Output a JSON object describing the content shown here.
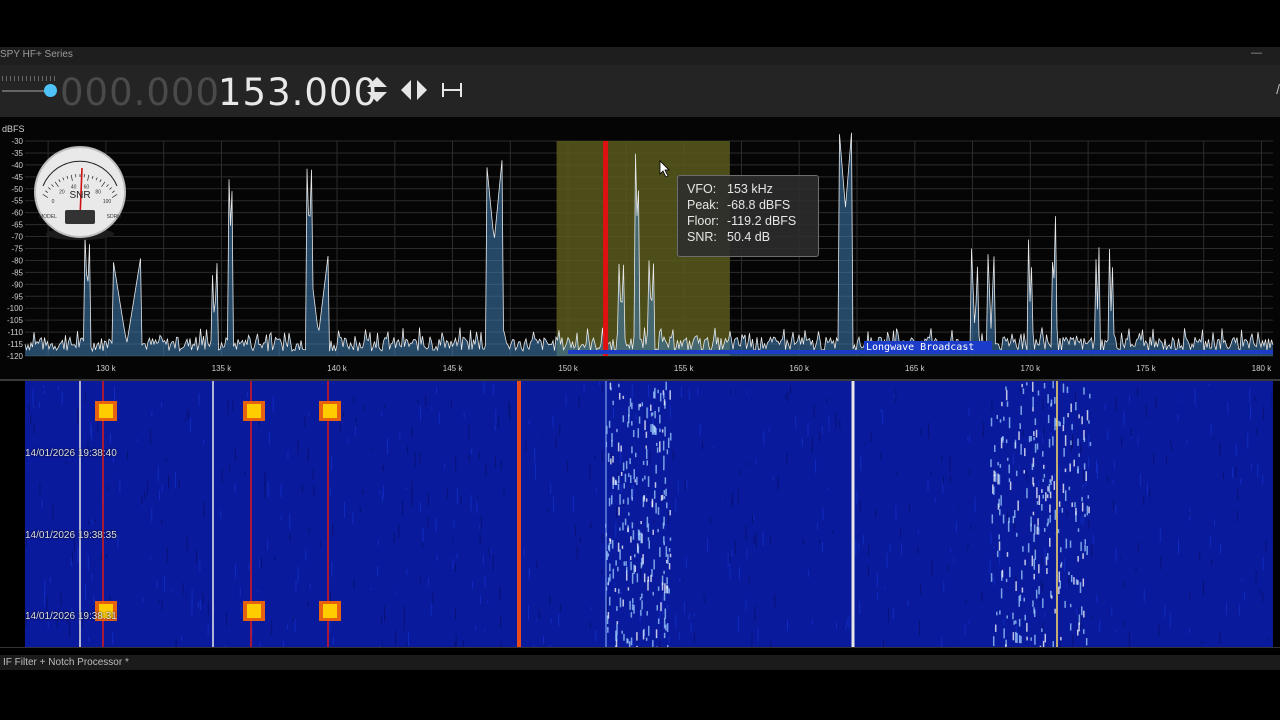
{
  "window": {
    "title": "SPY HF+ Series",
    "minimize_glyph": "—"
  },
  "toolbar": {
    "frequency_dim": "000.000.",
    "frequency_bright": "153.000",
    "icons": [
      "volume-slider",
      "tune-up-down-icon",
      "tune-left-right-icon",
      "span-width-icon"
    ]
  },
  "spectrum": {
    "unit_label": "dBFS",
    "db_ticks": [
      "-30",
      "-35",
      "-40",
      "-45",
      "-50",
      "-55",
      "-60",
      "-65",
      "-70",
      "-75",
      "-80",
      "-85",
      "-90",
      "-95",
      "-100",
      "-105",
      "-110",
      "-115",
      "-120"
    ],
    "freq_ticks": [
      "130 k",
      "135 k",
      "140 k",
      "145 k",
      "150 k",
      "155 k",
      "160 k",
      "165 k",
      "170 k",
      "175 k",
      "180 k"
    ],
    "band_label": "Longwave Broadcast",
    "snr_meter_label": "SNR",
    "snr_meter_scale": [
      "0",
      "20",
      "40",
      "60",
      "80",
      "100"
    ],
    "snr_meter_corner_left": "MODEL",
    "snr_meter_corner_right": "SDRM",
    "colors": {
      "filter_band": "#5a5a1e",
      "vfo_line": "#e01010",
      "signal_fill": "#3f7fb8",
      "trace": "#e8e8e8",
      "band_marker": "#1a3cc8"
    }
  },
  "tooltip": {
    "vfo_label": "VFO:",
    "vfo_value": "153 kHz",
    "peak_label": "Peak:",
    "peak_value": "-68.8 dBFS",
    "floor_label": "Floor:",
    "floor_value": "-119.2 dBFS",
    "snr_label": "SNR:",
    "snr_value": "50.4 dB"
  },
  "waterfall": {
    "timestamps": [
      "14/01/2026 19:38:40",
      "14/01/2026 19:38:35",
      "14/01/2026 19:38:31"
    ],
    "colors": {
      "background": "#0a1a9c",
      "hot": "#ffcc00"
    }
  },
  "status": {
    "text": "IF Filter + Notch Processor *"
  }
}
